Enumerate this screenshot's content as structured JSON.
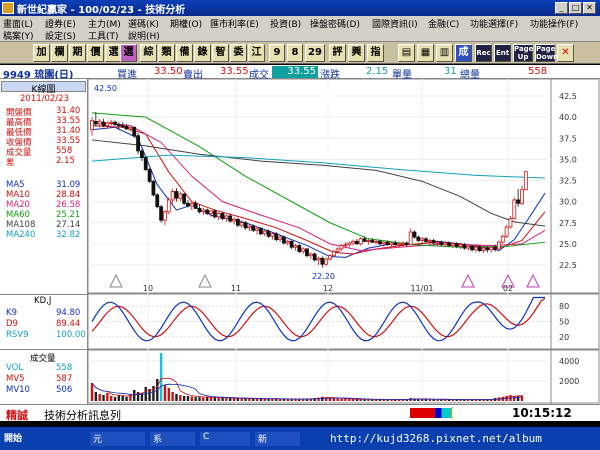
{
  "window": {
    "title": "新世紀贏家 - 100/02/23 - 技術分析"
  },
  "menu": {
    "row1": [
      "畫面(L)",
      "證券(E)",
      "主力(M)",
      "選碼(K)",
      "期權(O)",
      "匯市利率(E)",
      "投資(B)",
      "操盤密碼(D)",
      "國際資訊(I)",
      "金融(C)",
      "功能選擇(F)",
      "功能操作(F)"
    ],
    "row2": [
      "稿案(Y)",
      "設定(S)",
      "工具(T)",
      "說明(H)"
    ]
  },
  "toolbar": [
    "加",
    "欄",
    "期",
    "價",
    "選",
    "選",
    "綜",
    "類",
    "備",
    "錄",
    "智",
    "委",
    "江",
    "9",
    "8",
    "29",
    "評",
    "興",
    "指",
    "▤",
    "▦",
    "▥",
    "成",
    "Rec",
    "Ent",
    "Page Up",
    "Page Down",
    "✕"
  ],
  "stock": {
    "code_name": "9949 琉園(日)",
    "buy_label": "買進",
    "buy": "33.50",
    "sell_label": "賣出",
    "sell": "33.55",
    "deal_label": "成交",
    "deal": "33.55",
    "change_label": "漲跌",
    "change": "2.15",
    "vol_label": "單量",
    "vol": "31",
    "total_label": "總量",
    "total": "558"
  },
  "left_panel": {
    "kline_label": "K線圖",
    "date": "2011/02/23",
    "prices": [
      {
        "label": "開盤價",
        "value": "31.40",
        "color": "#d01010"
      },
      {
        "label": "最高價",
        "value": "33.55",
        "color": "#d01010"
      },
      {
        "label": "最低價",
        "value": "31.40",
        "color": "#d01010"
      },
      {
        "label": "收盤價",
        "value": "33.55",
        "color": "#d01010"
      },
      {
        "label": "成交量",
        "value": "558",
        "color": "#d01010"
      },
      {
        "label": "差",
        "value": "2.15",
        "color": "#d01010"
      }
    ],
    "ma": [
      {
        "label": "MA5",
        "value": "31.09",
        "color": "#1030c0"
      },
      {
        "label": "MA10",
        "value": "28.84",
        "color": "#d01010"
      },
      {
        "label": "MA20",
        "value": "26.58",
        "color": "#d02080"
      },
      {
        "label": "MA60",
        "value": "25.21",
        "color": "#10a010"
      },
      {
        "label": "MA108",
        "value": "27.14",
        "color": "#404040"
      },
      {
        "label": "MA240",
        "value": "32.82",
        "color": "#10a0c0"
      }
    ],
    "kd_title": "KD,J",
    "kd": [
      {
        "label": "K9",
        "value": "94.80",
        "color": "#1030c0"
      },
      {
        "label": "D9",
        "value": "89.44",
        "color": "#d01010"
      },
      {
        "label": "RSV9",
        "value": "100.00",
        "color": "#10a0c0"
      }
    ],
    "vol_title": "成交量",
    "vol": [
      {
        "label": "VOL",
        "value": "558",
        "color": "#10a0c0"
      },
      {
        "label": "MV5",
        "value": "587",
        "color": "#d01010"
      },
      {
        "label": "MV10",
        "value": "506",
        "color": "#1030c0"
      }
    ]
  },
  "chart_data": {
    "type": "candlestick",
    "y_ticks": [
      "42.5",
      "40.0",
      "37.5",
      "35.0",
      "32.5",
      "30.0",
      "27.5",
      "25.0",
      "22.5"
    ],
    "x_ticks": [
      "10",
      "11",
      "12",
      "11/01",
      "02"
    ],
    "high_label": "42.50",
    "low_label": "22.20",
    "kd_ticks": [
      "80",
      "50",
      "20"
    ],
    "vol_ticks": [
      "4000",
      "2000"
    ],
    "ma_lines": [
      {
        "name": "MA5",
        "color": "#1030c0",
        "points": [
          [
            0,
            38.5
          ],
          [
            6,
            38.8
          ],
          [
            12,
            37.5
          ],
          [
            17,
            32
          ],
          [
            22,
            29
          ],
          [
            26,
            29.6
          ],
          [
            31,
            28.4
          ],
          [
            40,
            27.5
          ],
          [
            48,
            26.2
          ],
          [
            56,
            24.8
          ],
          [
            62,
            23.5
          ],
          [
            66,
            23.4
          ],
          [
            72,
            24.5
          ],
          [
            78,
            25.0
          ],
          [
            84,
            24.9
          ],
          [
            90,
            25.3
          ],
          [
            96,
            25.0
          ],
          [
            102,
            24.6
          ],
          [
            106,
            24.2
          ],
          [
            110,
            25.5
          ],
          [
            114,
            28.2
          ],
          [
            118,
            31.0
          ]
        ]
      },
      {
        "name": "MA10",
        "color": "#d01010",
        "points": [
          [
            0,
            39
          ],
          [
            8,
            38.8
          ],
          [
            14,
            38
          ],
          [
            20,
            33.5
          ],
          [
            26,
            30
          ],
          [
            32,
            29
          ],
          [
            40,
            28
          ],
          [
            48,
            26.9
          ],
          [
            56,
            25.4
          ],
          [
            63,
            24
          ],
          [
            68,
            23.8
          ],
          [
            74,
            24.4
          ],
          [
            82,
            24.9
          ],
          [
            90,
            25.2
          ],
          [
            98,
            24.9
          ],
          [
            106,
            24.5
          ],
          [
            112,
            25.4
          ],
          [
            118,
            28.8
          ]
        ]
      },
      {
        "name": "MA20",
        "color": "#d02080",
        "points": [
          [
            0,
            39.5
          ],
          [
            10,
            39
          ],
          [
            18,
            37
          ],
          [
            26,
            33
          ],
          [
            34,
            30
          ],
          [
            44,
            28.4
          ],
          [
            54,
            26.9
          ],
          [
            62,
            25
          ],
          [
            70,
            24.2
          ],
          [
            80,
            24.6
          ],
          [
            92,
            25.0
          ],
          [
            104,
            24.8
          ],
          [
            112,
            25.0
          ],
          [
            118,
            26.6
          ]
        ]
      },
      {
        "name": "MA60",
        "color": "#10a010",
        "points": [
          [
            0,
            40.5
          ],
          [
            14,
            40
          ],
          [
            28,
            36.5
          ],
          [
            40,
            33
          ],
          [
            52,
            30
          ],
          [
            62,
            27.5
          ],
          [
            72,
            25.6
          ],
          [
            84,
            24.9
          ],
          [
            96,
            24.6
          ],
          [
            108,
            24.7
          ],
          [
            118,
            25.2
          ]
        ]
      },
      {
        "name": "MA108",
        "color": "#404040",
        "points": [
          [
            0,
            37.3
          ],
          [
            14,
            36.6
          ],
          [
            28,
            35.6
          ],
          [
            44,
            34.8
          ],
          [
            60,
            34.3
          ],
          [
            74,
            33.7
          ],
          [
            86,
            32.4
          ],
          [
            96,
            30.6
          ],
          [
            104,
            28.6
          ],
          [
            110,
            27.6
          ],
          [
            118,
            27.1
          ]
        ]
      },
      {
        "name": "MA240",
        "color": "#10a0c0",
        "points": [
          [
            0,
            34.8
          ],
          [
            20,
            35.5
          ],
          [
            40,
            35.2
          ],
          [
            60,
            34.6
          ],
          [
            80,
            33.8
          ],
          [
            100,
            33.1
          ],
          [
            118,
            32.8
          ]
        ]
      }
    ],
    "candles": [
      [
        0,
        38.5,
        40,
        37.8,
        39.6
      ],
      [
        1,
        39.5,
        40.6,
        38.9,
        39.2
      ],
      [
        2,
        39.2,
        39.8,
        38.8,
        39.5
      ],
      [
        3,
        39.4,
        39.8,
        38.8,
        39.0
      ],
      [
        4,
        39.0,
        39.5,
        38.6,
        39.3
      ],
      [
        5,
        39.3,
        39.7,
        39.0,
        39.4
      ],
      [
        6,
        39.4,
        39.6,
        39.0,
        39.1
      ],
      [
        7,
        39.1,
        39.4,
        38.5,
        39.0
      ],
      [
        8,
        39.0,
        39.4,
        38.7,
        38.9
      ],
      [
        9,
        38.9,
        39.2,
        38.5,
        38.6
      ],
      [
        10,
        38.6,
        38.9,
        38.3,
        38.8
      ],
      [
        11,
        38.8,
        38.9,
        37.6,
        37.8
      ],
      [
        12,
        37.8,
        38.1,
        35.6,
        36.0
      ],
      [
        13,
        36.0,
        36.2,
        34.8,
        35.2
      ],
      [
        14,
        35.2,
        35.4,
        33.6,
        33.8
      ],
      [
        15,
        33.8,
        34.0,
        32.2,
        32.4
      ],
      [
        16,
        32.4,
        32.6,
        30.6,
        30.8
      ],
      [
        17,
        30.8,
        31.0,
        29.2,
        29.4
      ],
      [
        18,
        29.4,
        29.6,
        27.5,
        27.8
      ],
      [
        19,
        27.8,
        29.0,
        27.2,
        28.8
      ],
      [
        20,
        28.8,
        30.5,
        28.5,
        30.2
      ],
      [
        21,
        30.2,
        31.5,
        29.8,
        31.2
      ],
      [
        22,
        31.2,
        31.6,
        30.0,
        30.4
      ],
      [
        23,
        30.4,
        31.2,
        30.0,
        30.9
      ],
      [
        24,
        30.9,
        31.0,
        29.6,
        29.8
      ],
      [
        25,
        29.8,
        30.2,
        29.3,
        29.5
      ],
      [
        26,
        29.5,
        30.0,
        29.0,
        29.8
      ],
      [
        27,
        29.8,
        30.1,
        29.1,
        29.2
      ],
      [
        28,
        29.2,
        29.6,
        28.6,
        28.8
      ],
      [
        29,
        28.8,
        29.3,
        28.4,
        29.0
      ],
      [
        30,
        29.0,
        29.2,
        28.4,
        28.6
      ],
      [
        31,
        28.6,
        29.0,
        28.2,
        28.9
      ],
      [
        32,
        28.9,
        29.1,
        28.0,
        28.2
      ],
      [
        33,
        28.2,
        28.8,
        27.8,
        28.6
      ],
      [
        34,
        28.6,
        28.8,
        27.8,
        28.0
      ],
      [
        35,
        28.0,
        28.5,
        27.6,
        28.3
      ],
      [
        36,
        28.3,
        28.6,
        27.5,
        27.7
      ],
      [
        37,
        27.7,
        28.2,
        27.3,
        27.9
      ],
      [
        38,
        27.9,
        28.1,
        27.0,
        27.2
      ],
      [
        39,
        27.2,
        27.8,
        26.9,
        27.5
      ],
      [
        40,
        27.5,
        27.7,
        26.7,
        26.9
      ],
      [
        41,
        26.9,
        27.3,
        26.5,
        27.1
      ],
      [
        42,
        27.1,
        27.3,
        26.4,
        26.6
      ],
      [
        43,
        26.6,
        27.0,
        26.1,
        26.8
      ],
      [
        44,
        26.8,
        27.0,
        26.0,
        26.2
      ],
      [
        45,
        26.2,
        26.7,
        25.9,
        26.5
      ],
      [
        46,
        26.5,
        26.7,
        25.7,
        25.9
      ],
      [
        47,
        25.9,
        26.4,
        25.5,
        26.2
      ],
      [
        48,
        26.2,
        26.4,
        25.3,
        25.5
      ],
      [
        49,
        25.5,
        26.0,
        25.2,
        25.8
      ],
      [
        50,
        25.8,
        26.0,
        24.9,
        25.1
      ],
      [
        51,
        25.1,
        25.5,
        24.8,
        25.3
      ],
      [
        52,
        25.3,
        25.4,
        24.4,
        24.6
      ],
      [
        53,
        24.6,
        25.0,
        24.2,
        24.8
      ],
      [
        54,
        24.8,
        25.0,
        23.9,
        24.1
      ],
      [
        55,
        24.1,
        24.6,
        23.8,
        24.4
      ],
      [
        56,
        24.4,
        24.5,
        23.4,
        23.6
      ],
      [
        57,
        23.6,
        24.0,
        23.2,
        23.8
      ],
      [
        58,
        23.8,
        24.0,
        22.9,
        23.1
      ],
      [
        59,
        23.1,
        23.5,
        22.5,
        23.3
      ],
      [
        60,
        23.3,
        23.5,
        22.2,
        22.6
      ],
      [
        61,
        22.6,
        23.4,
        22.4,
        23.2
      ],
      [
        62,
        23.2,
        23.8,
        23.0,
        23.6
      ],
      [
        63,
        23.6,
        24.3,
        23.4,
        24.1
      ],
      [
        64,
        24.1,
        24.6,
        23.9,
        24.4
      ],
      [
        65,
        24.4,
        25.0,
        24.2,
        24.8
      ],
      [
        66,
        24.8,
        25.2,
        24.5,
        24.9
      ],
      [
        67,
        24.9,
        25.3,
        24.6,
        25.1
      ],
      [
        68,
        25.1,
        25.5,
        24.8,
        25.3
      ],
      [
        69,
        25.3,
        25.6,
        24.9,
        25.0
      ],
      [
        70,
        25.0,
        25.8,
        24.8,
        25.6
      ],
      [
        71,
        25.6,
        25.9,
        25.2,
        25.3
      ],
      [
        72,
        25.3,
        25.6,
        24.9,
        25.4
      ],
      [
        73,
        25.4,
        25.7,
        25.1,
        25.2
      ],
      [
        74,
        25.2,
        25.5,
        24.9,
        25.3
      ],
      [
        75,
        25.3,
        25.5,
        24.8,
        25.0
      ],
      [
        76,
        25.0,
        25.3,
        24.7,
        25.2
      ],
      [
        77,
        25.2,
        25.4,
        24.8,
        24.9
      ],
      [
        78,
        24.9,
        25.3,
        24.6,
        25.1
      ],
      [
        79,
        25.1,
        25.4,
        24.8,
        24.9
      ],
      [
        80,
        24.9,
        25.2,
        24.6,
        25.0
      ],
      [
        81,
        25.0,
        25.3,
        24.7,
        25.1
      ],
      [
        82,
        25.1,
        25.3,
        24.7,
        24.9
      ],
      [
        83,
        24.9,
        26.8,
        24.8,
        26.4
      ],
      [
        84,
        26.4,
        26.6,
        25.6,
        25.8
      ],
      [
        85,
        25.8,
        26.0,
        25.2,
        25.4
      ],
      [
        86,
        25.4,
        25.8,
        25.1,
        25.6
      ],
      [
        87,
        25.6,
        25.8,
        25.1,
        25.3
      ],
      [
        88,
        25.3,
        25.6,
        24.9,
        25.4
      ],
      [
        89,
        25.4,
        25.6,
        24.9,
        25.1
      ],
      [
        90,
        25.1,
        25.4,
        24.8,
        25.2
      ],
      [
        91,
        25.2,
        25.4,
        24.7,
        24.9
      ],
      [
        92,
        24.9,
        25.3,
        24.6,
        25.1
      ],
      [
        93,
        25.1,
        25.3,
        24.6,
        24.8
      ],
      [
        94,
        24.8,
        25.2,
        24.5,
        25.0
      ],
      [
        95,
        25.0,
        25.2,
        24.5,
        24.7
      ],
      [
        96,
        24.7,
        25.1,
        24.4,
        24.9
      ],
      [
        97,
        24.9,
        25.1,
        24.3,
        24.5
      ],
      [
        98,
        24.5,
        24.9,
        24.2,
        24.7
      ],
      [
        99,
        24.7,
        24.9,
        24.1,
        24.3
      ],
      [
        100,
        24.3,
        24.8,
        24.0,
        24.6
      ],
      [
        101,
        24.6,
        24.8,
        24.0,
        24.2
      ],
      [
        102,
        24.2,
        24.7,
        23.9,
        24.5
      ],
      [
        103,
        24.5,
        24.7,
        24.0,
        24.3
      ],
      [
        104,
        24.3,
        24.8,
        24.0,
        24.6
      ],
      [
        105,
        24.6,
        24.9,
        24.1,
        24.4
      ],
      [
        106,
        24.4,
        25.4,
        24.3,
        25.2
      ],
      [
        107,
        25.2,
        26.1,
        25.0,
        25.9
      ],
      [
        108,
        25.9,
        27.2,
        25.7,
        27.0
      ],
      [
        109,
        27.0,
        28.3,
        26.8,
        28.0
      ],
      [
        110,
        28.0,
        30.5,
        27.9,
        30.2
      ],
      [
        111,
        30.2,
        31.5,
        29.4,
        29.8
      ],
      [
        112,
        29.8,
        31.9,
        29.6,
        31.4
      ],
      [
        113,
        31.4,
        33.55,
        31.4,
        33.55
      ]
    ]
  },
  "status": {
    "label": "精誠",
    "message": "技術分析訊息列",
    "time": "10:15:12"
  },
  "taskbar": {
    "start": "開始",
    "items": [
      "元",
      "系",
      "C",
      "新"
    ],
    "url": "http://kujd3268.pixnet.net/album"
  }
}
